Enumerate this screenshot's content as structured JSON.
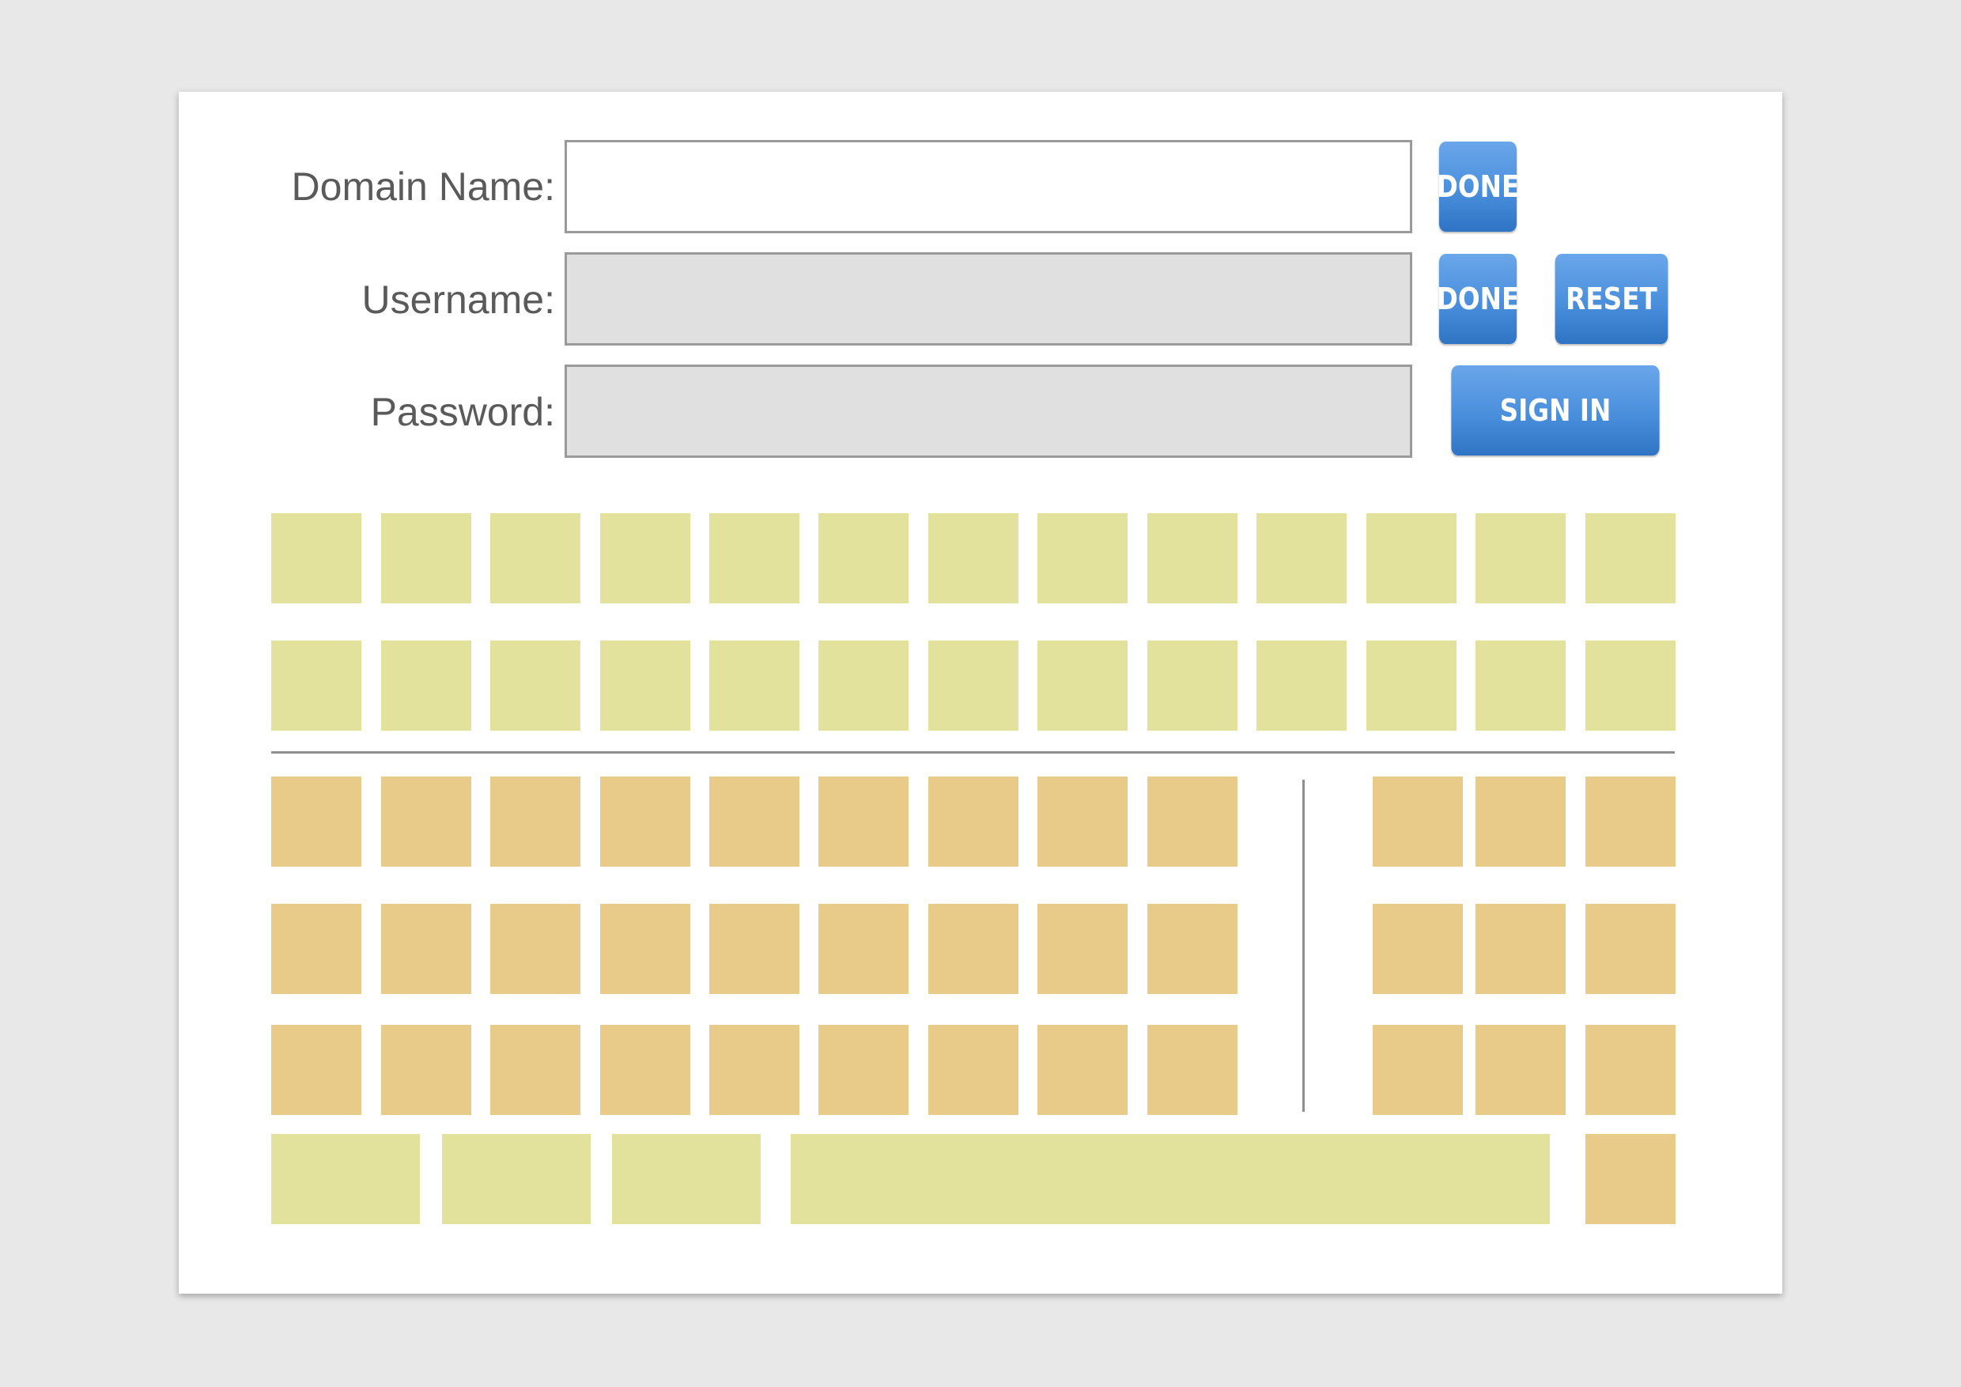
{
  "form": {
    "domain": {
      "label": "Domain Name:",
      "value": "",
      "button": "DONE"
    },
    "username": {
      "label": "Username:",
      "value": "",
      "button": "DONE",
      "reset": "RESET"
    },
    "password": {
      "label": "Password:",
      "value": "",
      "button": "SIGN IN"
    }
  },
  "colors": {
    "background": "#e8e8e8",
    "card": "#ffffff",
    "button": "#4a8fdc",
    "key_green": "#e3e29d",
    "key_orange": "#e8cb88",
    "input_disabled": "#e0e0e0"
  }
}
